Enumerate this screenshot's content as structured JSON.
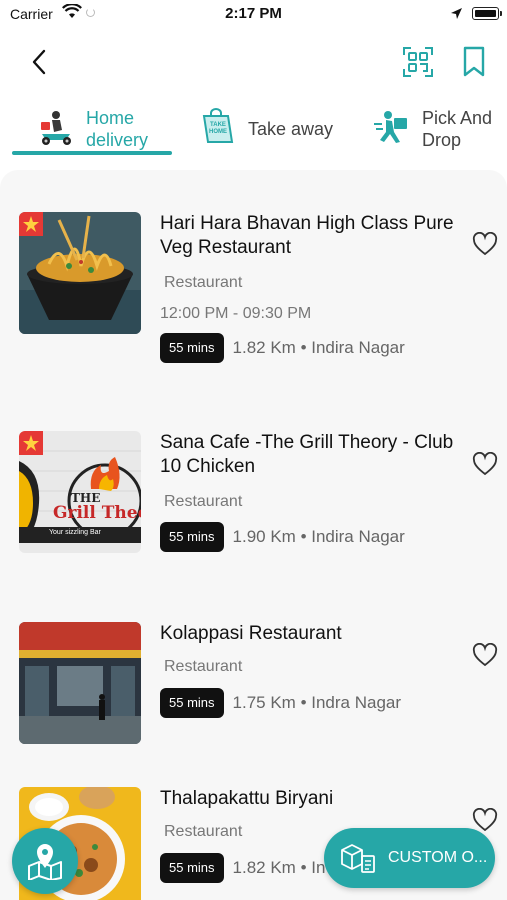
{
  "status_bar": {
    "carrier": "Carrier",
    "time": "2:17 PM"
  },
  "header": {
    "back_icon": "chevron-left-icon",
    "scan_icon": "qr-scan-icon",
    "bookmark_icon": "bookmark-icon"
  },
  "tabs": [
    {
      "label": "Home delivery",
      "line1": "Home",
      "line2": "delivery",
      "active": true,
      "icon": "scooter-delivery-icon"
    },
    {
      "label": "Take away",
      "line1": "Take away",
      "line2": "",
      "active": false,
      "icon": "take-home-bag-icon"
    },
    {
      "label": "Pick And Drop",
      "line1": "Pick And",
      "line2": "Drop",
      "active": false,
      "icon": "courier-running-icon"
    }
  ],
  "restaurants": [
    {
      "name": "Hari Hara Bhavan High Class Pure Veg Restaurant",
      "type": "Restaurant",
      "hours": "12:00 PM - 09:30 PM",
      "eta": "55 mins",
      "distance": "1.82 Km • Indira Nagar"
    },
    {
      "name": "Sana Cafe -The Grill Theory - Club 10 Chicken",
      "type": "Restaurant",
      "hours": "",
      "eta": "55 mins",
      "distance": "1.90 Km • Indira Nagar",
      "thumb_text_1": "THE",
      "thumb_text_2": "Grill Theo",
      "thumb_text_3": "Your sizzling Bar"
    },
    {
      "name": "Kolappasi Restaurant",
      "type": "Restaurant",
      "hours": "",
      "eta": "55 mins",
      "distance": "1.75 Km • Indra Nagar"
    },
    {
      "name": "Thalapakattu Biryani",
      "type": "Restaurant",
      "hours": "",
      "eta": "55 mins",
      "distance": "1.82 Km • In"
    }
  ],
  "fab": {
    "map_icon": "map-location-icon",
    "custom_label": "CUSTOM O...",
    "custom_icon": "boxes-icon"
  },
  "colors": {
    "accent": "#26a7a7",
    "flag": "#e53935",
    "badge": "#111111"
  }
}
